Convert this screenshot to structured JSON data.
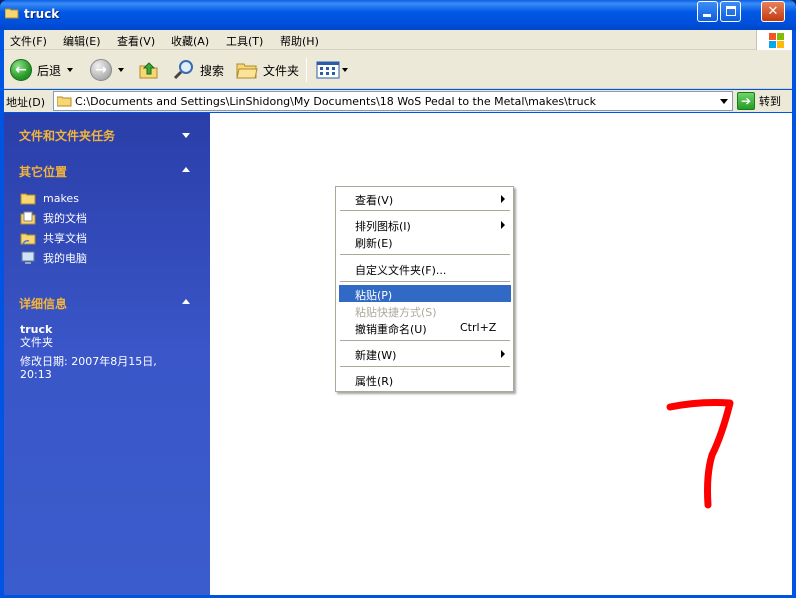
{
  "window": {
    "title": "truck",
    "icon": "folder-icon"
  },
  "menubar": {
    "items": [
      "文件(F)",
      "编辑(E)",
      "查看(V)",
      "收藏(A)",
      "工具(T)",
      "帮助(H)"
    ]
  },
  "toolbar": {
    "back_label": "后退",
    "search_label": "搜索",
    "folders_label": "文件夹"
  },
  "address": {
    "label": "地址(D)",
    "path": "C:\\Documents and Settings\\LinShidong\\My Documents\\18 WoS Pedal to the Metal\\makes\\truck",
    "go_label": "转到"
  },
  "taskpane": {
    "file_tasks_title": "文件和文件夹任务",
    "other_places_title": "其它位置",
    "other_places": [
      "makes",
      "我的文档",
      "共享文档",
      "我的电脑"
    ],
    "details_title": "详细信息",
    "details_name": "truck",
    "details_type": "文件夹",
    "details_modified_line1": "修改日期: 2007年8月15日,",
    "details_modified_line2": "20:13"
  },
  "context_menu": {
    "items": [
      {
        "label": "查看(V)",
        "submenu": true
      },
      {
        "label": "排列图标(I)",
        "submenu": true
      },
      {
        "label": "刷新(E)"
      },
      {
        "label": "自定义文件夹(F)..."
      },
      {
        "label": "粘贴(P)",
        "highlighted": true
      },
      {
        "label": "粘贴快捷方式(S)",
        "disabled": true
      },
      {
        "label": "撤销重命名(U)",
        "shortcut": "Ctrl+Z"
      },
      {
        "label": "新建(W)",
        "submenu": true
      },
      {
        "label": "属性(R)"
      }
    ]
  },
  "annotation": {
    "number": "7",
    "color": "#ff0000"
  },
  "colors": {
    "highlight": "#316ac5",
    "taskpane_heading": "#f2b43a"
  }
}
